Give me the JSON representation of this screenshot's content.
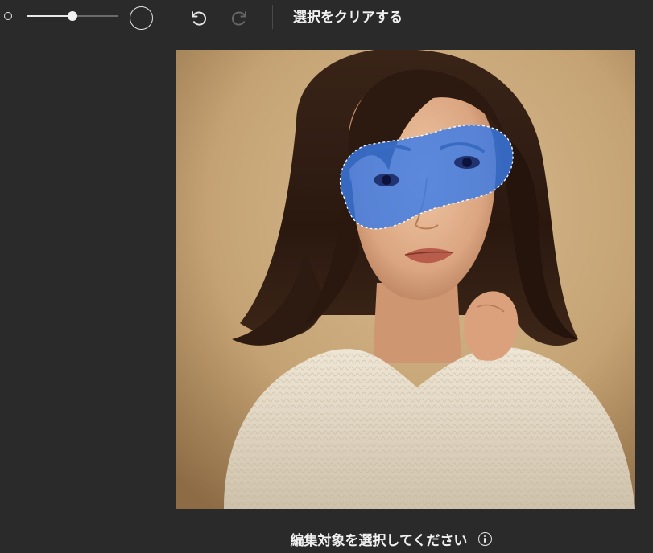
{
  "toolbar": {
    "brush_size_fraction": 0.5,
    "clear_label": "選択をクリアする",
    "undo_enabled": true,
    "redo_enabled": false
  },
  "canvas": {
    "mask_color": "#3b7be8",
    "content": "portrait photo with brush selection over eyes"
  },
  "footer": {
    "hint": "編集対象を選択してください"
  },
  "colors": {
    "background": "#2a2a2a",
    "text": "#f0f0f0",
    "icon": "#e6e6e6",
    "icon_disabled": "#666666",
    "accent": "#3b7be8"
  },
  "icons": {
    "undo": "undo-icon",
    "redo": "redo-icon",
    "info": "info-icon",
    "brush_small": "brush-small-icon",
    "brush_large": "brush-large-icon"
  }
}
